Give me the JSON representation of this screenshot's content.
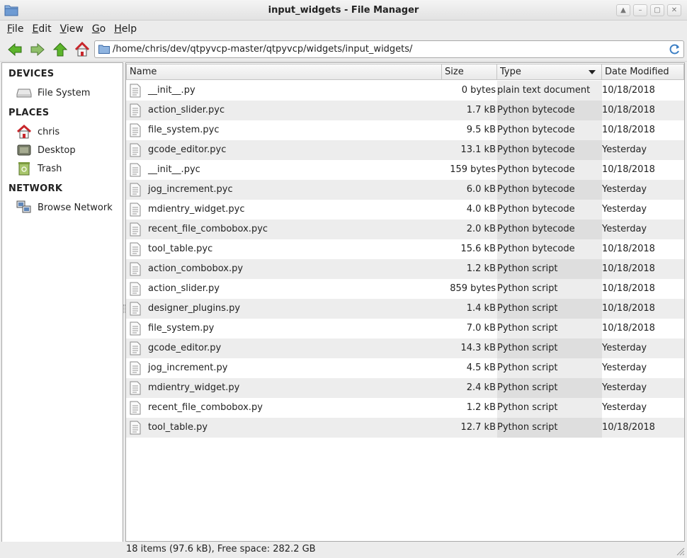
{
  "window": {
    "title": "input_widgets - File Manager"
  },
  "menubar": {
    "items": [
      {
        "label": "File",
        "mnemonic": "F",
        "rest": "ile"
      },
      {
        "label": "Edit",
        "mnemonic": "E",
        "rest": "dit"
      },
      {
        "label": "View",
        "mnemonic": "V",
        "rest": "iew"
      },
      {
        "label": "Go",
        "mnemonic": "G",
        "rest": "o"
      },
      {
        "label": "Help",
        "mnemonic": "H",
        "rest": "elp"
      }
    ]
  },
  "toolbar": {
    "location": "/home/chris/dev/qtpyvcp-master/qtpyvcp/widgets/input_widgets/"
  },
  "sidebar": {
    "devices_header": "DEVICES",
    "places_header": "PLACES",
    "network_header": "NETWORK",
    "devices": [
      {
        "label": "File System",
        "icon": "drive-icon"
      }
    ],
    "places": [
      {
        "label": "chris",
        "icon": "home-icon"
      },
      {
        "label": "Desktop",
        "icon": "desktop-icon"
      },
      {
        "label": "Trash",
        "icon": "trash-icon"
      }
    ],
    "network": [
      {
        "label": "Browse Network",
        "icon": "network-icon"
      }
    ]
  },
  "filelist": {
    "columns": {
      "name": "Name",
      "size": "Size",
      "type": "Type",
      "date": "Date Modified"
    },
    "rows": [
      {
        "name": "__init__.py",
        "size": "0 bytes",
        "type": "plain text document",
        "date": "10/18/2018"
      },
      {
        "name": "action_slider.pyc",
        "size": "1.7 kB",
        "type": "Python bytecode",
        "date": "10/18/2018"
      },
      {
        "name": "file_system.pyc",
        "size": "9.5 kB",
        "type": "Python bytecode",
        "date": "10/18/2018"
      },
      {
        "name": "gcode_editor.pyc",
        "size": "13.1 kB",
        "type": "Python bytecode",
        "date": "Yesterday"
      },
      {
        "name": "__init__.pyc",
        "size": "159 bytes",
        "type": "Python bytecode",
        "date": "10/18/2018"
      },
      {
        "name": "jog_increment.pyc",
        "size": "6.0 kB",
        "type": "Python bytecode",
        "date": "Yesterday"
      },
      {
        "name": "mdientry_widget.pyc",
        "size": "4.0 kB",
        "type": "Python bytecode",
        "date": "Yesterday"
      },
      {
        "name": "recent_file_combobox.pyc",
        "size": "2.0 kB",
        "type": "Python bytecode",
        "date": "Yesterday"
      },
      {
        "name": "tool_table.pyc",
        "size": "15.6 kB",
        "type": "Python bytecode",
        "date": "10/18/2018"
      },
      {
        "name": "action_combobox.py",
        "size": "1.2 kB",
        "type": "Python script",
        "date": "10/18/2018"
      },
      {
        "name": "action_slider.py",
        "size": "859 bytes",
        "type": "Python script",
        "date": "10/18/2018"
      },
      {
        "name": "designer_plugins.py",
        "size": "1.4 kB",
        "type": "Python script",
        "date": "10/18/2018"
      },
      {
        "name": "file_system.py",
        "size": "7.0 kB",
        "type": "Python script",
        "date": "10/18/2018"
      },
      {
        "name": "gcode_editor.py",
        "size": "14.3 kB",
        "type": "Python script",
        "date": "Yesterday"
      },
      {
        "name": "jog_increment.py",
        "size": "4.5 kB",
        "type": "Python script",
        "date": "Yesterday"
      },
      {
        "name": "mdientry_widget.py",
        "size": "2.4 kB",
        "type": "Python script",
        "date": "Yesterday"
      },
      {
        "name": "recent_file_combobox.py",
        "size": "1.2 kB",
        "type": "Python script",
        "date": "Yesterday"
      },
      {
        "name": "tool_table.py",
        "size": "12.7 kB",
        "type": "Python script",
        "date": "10/18/2018"
      }
    ]
  },
  "statusbar": {
    "text": "18 items (97.6 kB), Free space: 282.2 GB"
  },
  "colors": {
    "nav_green": "#4caf20",
    "home_red": "#c8262b",
    "row_alt": "#ededed",
    "type_col_alt": "#dedede"
  }
}
